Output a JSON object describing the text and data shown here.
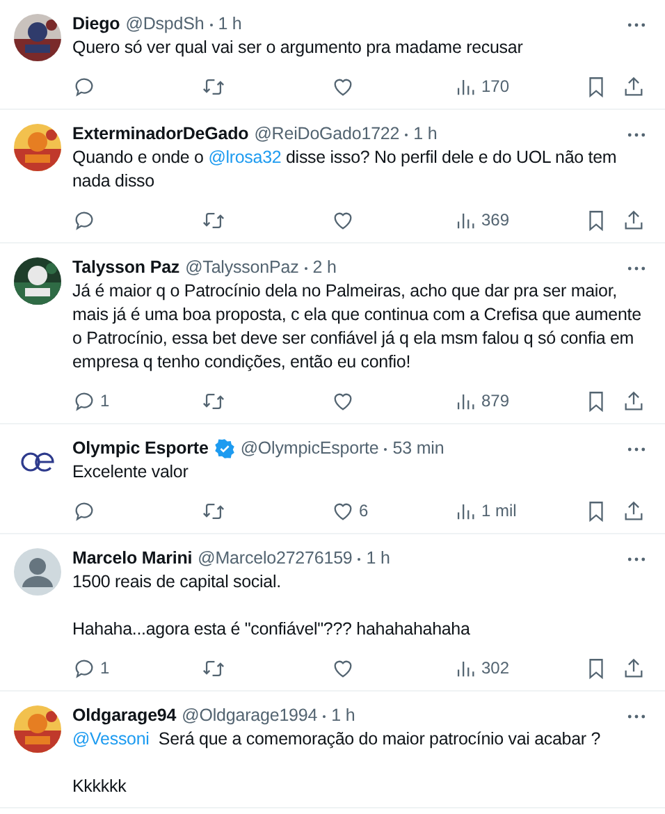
{
  "tweets": [
    {
      "name": "Diego",
      "handle": "@DspdSh",
      "time": "1 h",
      "verified": false,
      "avatar": {
        "kind": "picture"
      },
      "paragraphs": [
        [
          {
            "kind": "text",
            "text": "Quero só ver qual vai ser o argumento pra madame recusar"
          }
        ]
      ],
      "actions": {
        "views": "170"
      }
    },
    {
      "name": "ExterminadorDeGado",
      "handle": "@ReiDoGado1722",
      "time": "1 h",
      "verified": false,
      "avatar": {
        "kind": "picture"
      },
      "paragraphs": [
        [
          {
            "kind": "text",
            "text": "Quando e onde o "
          },
          {
            "kind": "mention",
            "text": "@lrosa32"
          },
          {
            "kind": "text",
            "text": " disse isso? No perfil dele e do UOL não tem nada disso"
          }
        ]
      ],
      "actions": {
        "views": "369"
      }
    },
    {
      "name": "Talysson Paz",
      "handle": "@TalyssonPaz",
      "time": "2 h",
      "verified": false,
      "avatar": {
        "kind": "picture"
      },
      "paragraphs": [
        [
          {
            "kind": "text",
            "text": "Já é maior q o Patrocínio dela no Palmeiras, acho que dar pra ser maior, mais já é uma boa proposta, c ela que continua com a Crefisa que aumente o Patrocínio, essa bet deve ser confiável já q ela msm falou q só confia em empresa q tenho condições, então eu confio!"
          }
        ]
      ],
      "actions": {
        "replies": "1",
        "views": "879"
      }
    },
    {
      "name": "Olympic Esporte",
      "handle": "@OlympicEsporte",
      "time": "53 min",
      "verified": true,
      "avatar": {
        "kind": "logo"
      },
      "paragraphs": [
        [
          {
            "kind": "text",
            "text": "Excelente valor"
          }
        ]
      ],
      "actions": {
        "likes": "6",
        "views": "1 mil"
      }
    },
    {
      "name": "Marcelo Marini",
      "handle": "@Marcelo27276159",
      "time": "1 h",
      "verified": false,
      "avatar": {
        "kind": "default"
      },
      "paragraphs": [
        [
          {
            "kind": "text",
            "text": "1500 reais de capital social."
          }
        ],
        [
          {
            "kind": "text",
            "text": "Hahaha...agora esta é \"confiável\"??? hahahahahaha"
          }
        ]
      ],
      "actions": {
        "replies": "1",
        "views": "302"
      }
    },
    {
      "name": "Oldgarage94",
      "handle": "@Oldgarage1994",
      "time": "1 h",
      "verified": false,
      "avatar": {
        "kind": "picture"
      },
      "paragraphs": [
        [
          {
            "kind": "mention",
            "text": "@Vessoni"
          },
          {
            "kind": "text",
            "text": "  Será que a comemoração do maior patrocínio vai acabar ?"
          }
        ],
        [
          {
            "kind": "text",
            "text": "Kkkkkk"
          }
        ]
      ]
    }
  ]
}
